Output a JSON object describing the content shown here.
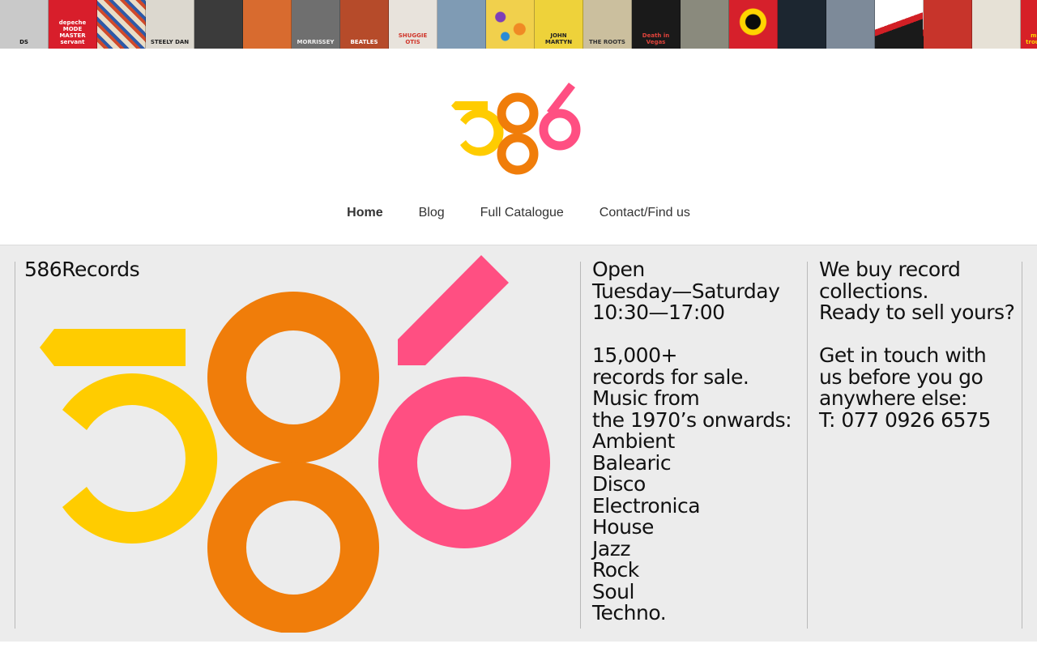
{
  "album_strip": {
    "covers": [
      {
        "text": "DS",
        "bg": "#c9c9c9",
        "fg": "#111"
      },
      {
        "text": "depeche\nMODE\nMASTER\nservant",
        "bg": "#d81e2b",
        "fg": "#ffffff"
      },
      {
        "text": "",
        "bg": "#c8b89a",
        "fg": "#111"
      },
      {
        "text": "STEELY DAN",
        "bg": "#dcd8cf",
        "fg": "#222"
      },
      {
        "text": "",
        "bg": "#3b3b3b",
        "fg": "#fff"
      },
      {
        "text": "",
        "bg": "#d86b2f",
        "fg": "#fff"
      },
      {
        "text": "MORRISSEY",
        "bg": "#6f6f6f",
        "fg": "#eee"
      },
      {
        "text": "BEATLES",
        "bg": "#b64b2a",
        "fg": "#fff"
      },
      {
        "text": "SHUGGIE OTIS",
        "bg": "#e8e3dc",
        "fg": "#d0352a"
      },
      {
        "text": "",
        "bg": "#7f9bb4",
        "fg": "#fff"
      },
      {
        "text": "",
        "bg": "#f3d54e",
        "fg": "#222"
      },
      {
        "text": "JOHN\nMARTYN",
        "bg": "#eed23a",
        "fg": "#222"
      },
      {
        "text": "THE ROOTS",
        "bg": "#cbbf9e",
        "fg": "#333"
      },
      {
        "text": "Death in Vegas",
        "bg": "#1a1a1a",
        "fg": "#e0433b"
      },
      {
        "text": "",
        "bg": "#8a8a7d",
        "fg": "#fff"
      },
      {
        "text": "",
        "bg": "#d6202b",
        "fg": "#fff"
      },
      {
        "text": "",
        "bg": "#1c2630",
        "fg": "#fff"
      },
      {
        "text": "",
        "bg": "#7d8a99",
        "fg": "#fff"
      },
      {
        "text": "",
        "bg": "#d9d9d9",
        "fg": "#222"
      },
      {
        "text": "",
        "bg": "#c7342b",
        "fg": "#fff"
      },
      {
        "text": "",
        "bg": "#e6e1d6",
        "fg": "#222"
      },
      {
        "text": "mr.scruff\ntrouser jazz",
        "bg": "#d62027",
        "fg": "#ffd400"
      }
    ],
    "extra_covers": [
      {
        "text": "",
        "bg": "#a7a05a",
        "fg": "#fff"
      }
    ]
  },
  "brand": {
    "logo_colors": {
      "yellow": "#ffcc00",
      "orange": "#f07d0a",
      "pink": "#ff4f82"
    }
  },
  "nav": {
    "items": [
      {
        "label": "Home",
        "active": true
      },
      {
        "label": "Blog",
        "active": false
      },
      {
        "label": "Full Catalogue",
        "active": false
      },
      {
        "label": "Contact/Find us",
        "active": false
      }
    ]
  },
  "panel": {
    "store_name": "586Records",
    "hours": {
      "open_label": "Open",
      "days": "Tuesday—Saturday",
      "times": "10:30—17:00"
    },
    "stock": {
      "count": "15,000+",
      "count_text": "records for sale.",
      "music_from": "Music from",
      "era": "the 1970’s onwards:",
      "genres": [
        "Ambient",
        "Balearic",
        "Disco",
        "Electronica",
        "House",
        "Jazz",
        "Rock",
        "Soul",
        "Techno."
      ]
    },
    "buying": {
      "line1": "We buy record",
      "line2": "collections.",
      "line3": "Ready to sell yours?",
      "contact1": "Get in touch with",
      "contact2": "us before you go",
      "contact3": "anywhere else:",
      "phone": "T: 077 0926 6575"
    }
  }
}
